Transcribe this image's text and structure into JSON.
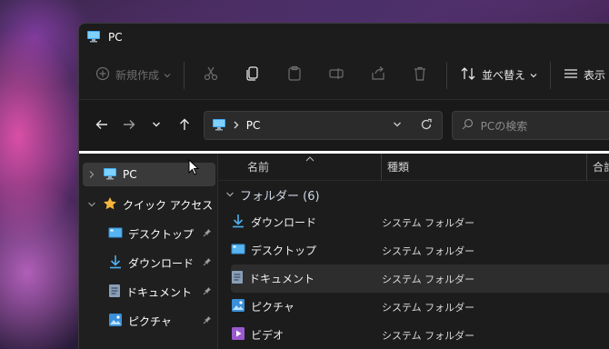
{
  "window": {
    "title": "PC"
  },
  "toolbar": {
    "new_label": "新規作成",
    "sort_label": "並べ替え",
    "view_label": "表示"
  },
  "navbar": {
    "address_segment": "PC",
    "search_placeholder": "PCの検索"
  },
  "sidebar": {
    "items": [
      {
        "label": "PC"
      },
      {
        "label": "クイック アクセス"
      },
      {
        "label": "デスクトップ"
      },
      {
        "label": "ダウンロード"
      },
      {
        "label": "ドキュメント"
      },
      {
        "label": "ピクチャ"
      }
    ]
  },
  "columns": {
    "name": "名前",
    "type": "種類",
    "size": "合計"
  },
  "group": {
    "label": "フォルダー (6)"
  },
  "files": [
    {
      "name": "ダウンロード",
      "type": "システム フォルダー",
      "icon": "download-icon"
    },
    {
      "name": "デスクトップ",
      "type": "システム フォルダー",
      "icon": "desktop-icon"
    },
    {
      "name": "ドキュメント",
      "type": "システム フォルダー",
      "icon": "document-icon"
    },
    {
      "name": "ピクチャ",
      "type": "システム フォルダー",
      "icon": "picture-icon"
    },
    {
      "name": "ビデオ",
      "type": "システム フォルダー",
      "icon": "video-icon"
    }
  ],
  "colors": {
    "accent": "#4cc2ff",
    "window_bg": "#202020",
    "selection": "#3a3a3a"
  }
}
